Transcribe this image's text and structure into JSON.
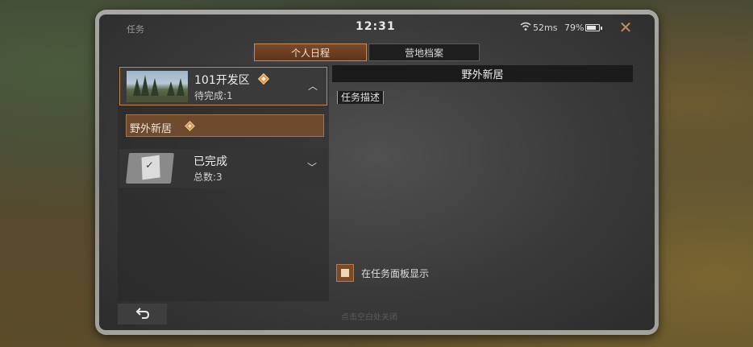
{
  "status_bar": {
    "title": "任务",
    "time": "12:31",
    "ping": "52ms",
    "battery": "79%",
    "icons": [
      "wifi-icon",
      "battery-icon",
      "close-icon"
    ]
  },
  "tabs": [
    {
      "label": "个人日程",
      "active": true
    },
    {
      "label": "营地档案",
      "active": false
    }
  ],
  "left_panel": {
    "zone": {
      "name": "101开发区",
      "pending": "待完成:1",
      "expanded": true
    },
    "tasks": [
      {
        "name": "野外新居"
      }
    ],
    "completed": {
      "label": "已完成",
      "total": "总数:3",
      "expanded": false
    }
  },
  "right_panel": {
    "title": "野外新居",
    "description_label": "任务描述",
    "show_on_panel": {
      "label": "在任务面板显示",
      "checked": true
    }
  },
  "footer": {
    "hint": "点击空白处关闭",
    "back_icon": "back-arrow-icon"
  },
  "colors": {
    "accent": "#c6884f",
    "active_tab": "#6e4a2e",
    "panel_dark": "#1b1b1b"
  }
}
